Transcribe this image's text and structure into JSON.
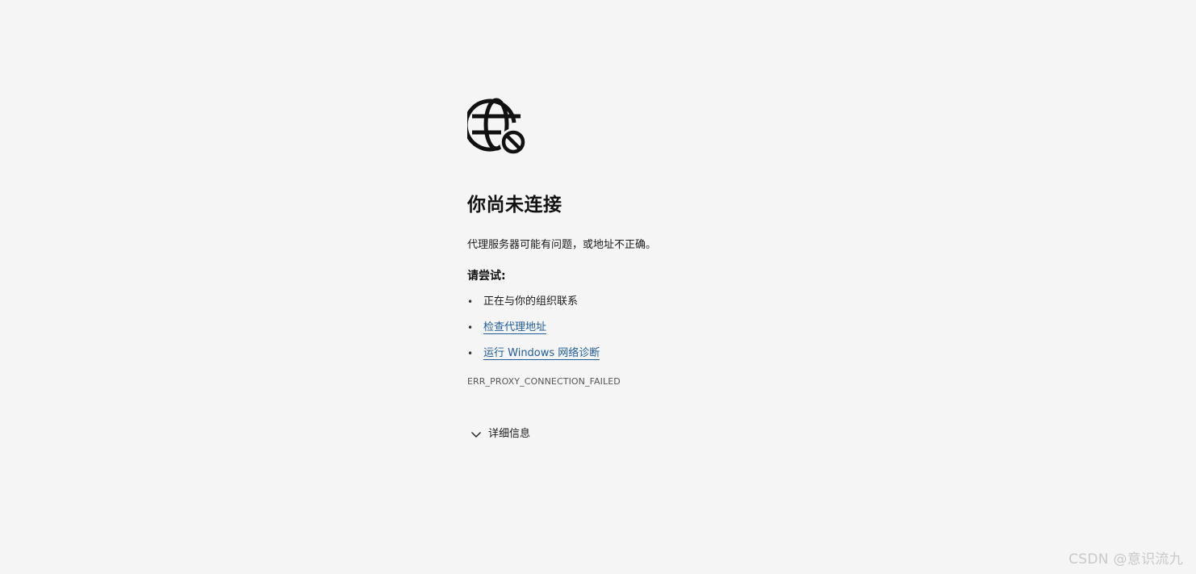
{
  "page": {
    "icon": "globe-blocked-icon",
    "title": "你尚未连接",
    "description": "代理服务器可能有问题，或地址不正确。",
    "try_label": "请尝试:",
    "suggestions": [
      {
        "text": "正在与你的组织联系",
        "is_link": false
      },
      {
        "text": "检查代理地址",
        "is_link": true
      },
      {
        "text": "运行 Windows 网络诊断",
        "is_link": true
      }
    ],
    "bullet": "•",
    "error_code": "ERR_PROXY_CONNECTION_FAILED",
    "details_label": "详细信息",
    "details_icon": "chevron-down-icon"
  },
  "watermark": "CSDN @意识流九",
  "colors": {
    "background": "#f5f5f5",
    "link": "#1f5c9a",
    "text": "#1a1a1a",
    "muted": "#555555"
  }
}
